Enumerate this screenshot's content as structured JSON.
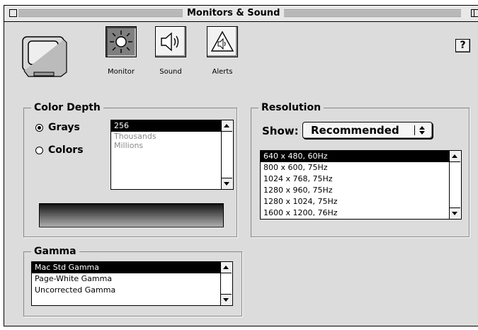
{
  "window": {
    "title": "Monitors & Sound"
  },
  "toolbar": {
    "buttons": [
      {
        "label": "Monitor",
        "icon": "sun-icon",
        "selected": true
      },
      {
        "label": "Sound",
        "icon": "speaker-icon",
        "selected": false
      },
      {
        "label": "Alerts",
        "icon": "alert-triangle-icon",
        "selected": false
      }
    ],
    "help_label": "?"
  },
  "color_depth": {
    "title": "Color Depth",
    "radios": [
      {
        "label": "Grays",
        "checked": true
      },
      {
        "label": "Colors",
        "checked": false
      }
    ],
    "list": [
      "256",
      "Thousands",
      "Millions"
    ],
    "selected_index": 0
  },
  "resolution": {
    "title": "Resolution",
    "show_label": "Show:",
    "show_value": "Recommended",
    "list": [
      "640 x 480, 60Hz",
      "800 x 600, 75Hz",
      "1024 x 768, 75Hz",
      "1280 x 960, 75Hz",
      "1280 x 1024, 75Hz",
      "1600 x 1200, 76Hz"
    ],
    "selected_index": 0
  },
  "gamma": {
    "title": "Gamma",
    "list": [
      "Mac Std Gamma",
      "Page-White Gamma",
      "Uncorrected Gamma"
    ],
    "selected_index": 0
  },
  "colors": {
    "window_bg": "#dcdcdc",
    "selection": "#000000",
    "dimmed_text": "#8a8a8a"
  }
}
